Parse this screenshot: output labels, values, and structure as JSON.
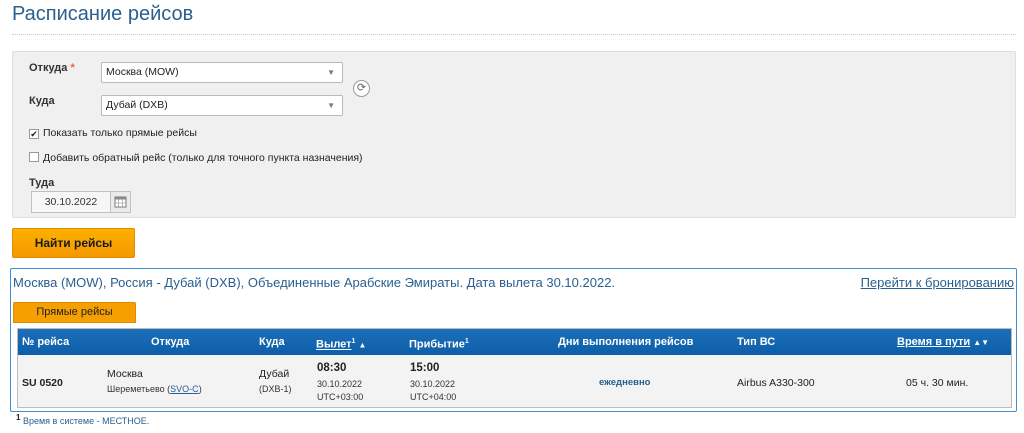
{
  "page": {
    "title": "Расписание рейсов"
  },
  "form": {
    "from_label": "Откуда",
    "required_mark": "*",
    "from_value": "Москва (MOW)",
    "to_label": "Куда",
    "to_value": "Дубай (DXB)",
    "direct_only_label": "Показать только прямые рейсы",
    "direct_only_checked": true,
    "return_label": "Добавить обратный рейс (только для точного пункта назначения)",
    "return_checked": false,
    "date_label": "Туда",
    "date_value": "30.10.2022",
    "find_button": "Найти рейсы"
  },
  "results": {
    "heading": "Москва (MOW), Россия - Дубай (DXB), Объединенные Арабские Эмираты. Дата вылета 30.10.2022.",
    "booking_link": "Перейти к бронированию",
    "tab_direct": "Прямые рейсы",
    "columns": {
      "flight_no": "№ рейса",
      "from": "Откуда",
      "to": "Куда",
      "departure": "Вылет",
      "arrival": "Прибытие",
      "days": "Дни выполнения рейсов",
      "aircraft": "Тип ВС",
      "duration": "Время в пути"
    },
    "flights": [
      {
        "flight_no": "SU 0520",
        "from_city": "Москва",
        "from_airport": "Шереметьево",
        "from_iata": "SVO-C",
        "to_city": "Дубай",
        "to_airport": "(DXB-1)",
        "dep_time": "08:30",
        "dep_date": "30.10.2022",
        "dep_tz": "UTC+03:00",
        "arr_time": "15:00",
        "arr_date": "30.10.2022",
        "arr_tz": "UTC+04:00",
        "days": "ежедневно",
        "aircraft": "Airbus A330-300",
        "duration": "05 ч. 30 мин."
      }
    ]
  },
  "footnote": {
    "mark": "1",
    "text": "Время в системе - МЕСТНОЕ."
  },
  "colors": {
    "accent": "#2a5f8e",
    "button": "#f39800",
    "table_header": "#1166b0"
  }
}
